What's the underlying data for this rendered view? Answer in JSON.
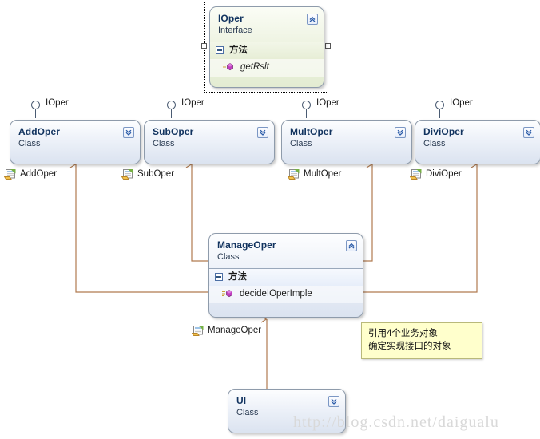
{
  "diagram": {
    "title": "UML class diagram",
    "watermark": "http://blog.csdn.net/daigualu",
    "colors": {
      "connector": "#b07a4f",
      "class_border": "#8e9bab",
      "class_name": "#11335f",
      "note_background": "#ffffcc",
      "note_border": "#b9b97a",
      "lollipop": "#4a5b72"
    }
  },
  "shapes": {
    "ioper": {
      "name": "IOper",
      "stereotype": "Interface",
      "selected": true,
      "compartment": {
        "label": "方法",
        "members": [
          {
            "name": "getRslt",
            "italic": true,
            "icon": "method-icon"
          }
        ]
      },
      "collapse_icon": "chevron-up-icon"
    },
    "addoper": {
      "name": "AddOper",
      "stereotype": "Class",
      "collapse_icon": "chevron-down-icon",
      "interface_label": "IOper",
      "tag_label": "AddOper",
      "tag_icon": "class-file-icon"
    },
    "suboper": {
      "name": "SubOper",
      "stereotype": "Class",
      "collapse_icon": "chevron-down-icon",
      "interface_label": "IOper",
      "tag_label": "SubOper",
      "tag_icon": "class-file-icon"
    },
    "multoper": {
      "name": "MultOper",
      "stereotype": "Class",
      "collapse_icon": "chevron-down-icon",
      "interface_label": "IOper",
      "tag_label": "MultOper",
      "tag_icon": "class-file-icon"
    },
    "divioper": {
      "name": "DiviOper",
      "stereotype": "Class",
      "collapse_icon": "chevron-down-icon",
      "interface_label": "IOper",
      "tag_label": "DiviOper",
      "tag_icon": "class-file-icon"
    },
    "manageoper": {
      "name": "ManageOper",
      "stereotype": "Class",
      "collapse_icon": "chevron-up-icon",
      "compartment": {
        "label": "方法",
        "members": [
          {
            "name": "decideIOperImple",
            "italic": false,
            "icon": "method-icon"
          }
        ]
      },
      "tag_label": "ManageOper",
      "tag_icon": "class-file-icon"
    },
    "ui": {
      "name": "UI",
      "stereotype": "Class",
      "collapse_icon": "chevron-down-icon"
    }
  },
  "note": {
    "line1": "引用4个业务对象",
    "line2": "确定实现接口的对象"
  }
}
